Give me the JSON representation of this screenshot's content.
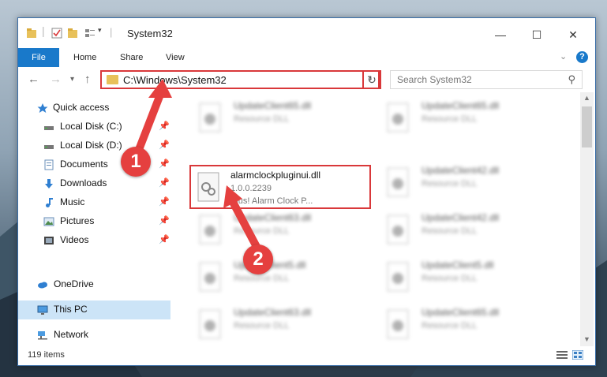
{
  "window": {
    "title": "System32",
    "controls": {
      "minimize": "—",
      "maximize": "☐",
      "close": "✕"
    }
  },
  "ribbon": {
    "tabs": [
      "File",
      "Home",
      "Share",
      "View"
    ],
    "help": "?"
  },
  "address": {
    "path": "C:\\Windows\\System32",
    "search_placeholder": "Search System32"
  },
  "sidebar": {
    "items": [
      {
        "label": "Quick access",
        "icon": "star-icon",
        "pinned": false
      },
      {
        "label": "Local Disk (C:)",
        "icon": "drive-icon",
        "pinned": true
      },
      {
        "label": "Local Disk (D:)",
        "icon": "drive-icon",
        "pinned": true
      },
      {
        "label": "Documents",
        "icon": "documents-icon",
        "pinned": true
      },
      {
        "label": "Downloads",
        "icon": "download-icon",
        "pinned": true
      },
      {
        "label": "Music",
        "icon": "music-icon",
        "pinned": true
      },
      {
        "label": "Pictures",
        "icon": "pictures-icon",
        "pinned": true
      },
      {
        "label": "Videos",
        "icon": "videos-icon",
        "pinned": true
      },
      {
        "label": "OneDrive",
        "icon": "cloud-icon",
        "pinned": false
      },
      {
        "label": "This PC",
        "icon": "computer-icon",
        "pinned": false,
        "selected": true
      },
      {
        "label": "Network",
        "icon": "network-icon",
        "pinned": false
      }
    ]
  },
  "files": {
    "highlighted": {
      "name": "alarmclockpluginui.dll",
      "version": "1.0.0.2239",
      "description": "Plus! Alarm Clock P..."
    },
    "left_column": [
      {
        "name": "UpdateClient65.dll",
        "type": "Resource DLL"
      },
      {
        "name": "UpdateClient63.dll",
        "type": "Resource DLL"
      },
      {
        "name": "UpdateClient5.dll",
        "type": "Resource DLL"
      },
      {
        "name": "UpdateClient63.dll",
        "type": "Resource DLL"
      }
    ],
    "right_column": [
      {
        "name": "UpdateClient65.dll",
        "type": "Resource DLL"
      },
      {
        "name": "UpdateClient42.dll",
        "type": "Resource DLL"
      },
      {
        "name": "UpdateClient42.dll",
        "type": "Resource DLL"
      },
      {
        "name": "UpdateClient5.dll",
        "type": "Resource DLL"
      },
      {
        "name": "UpdateClient65.dll",
        "type": "Resource DLL"
      }
    ]
  },
  "status": {
    "item_count": "119 items"
  },
  "annotations": {
    "step1": "1",
    "step2": "2"
  },
  "colors": {
    "accent": "#1979ca",
    "highlight_border": "#d9383a",
    "badge": "#e5403f",
    "selected_bg": "#cce4f7"
  }
}
